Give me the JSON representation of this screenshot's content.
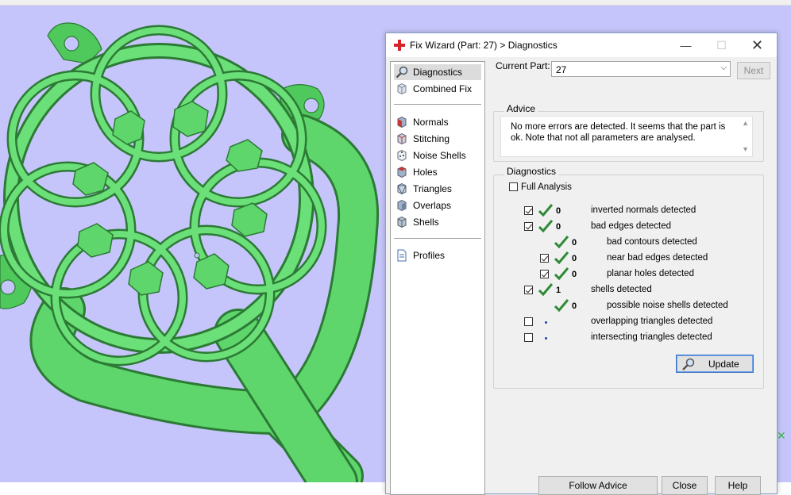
{
  "dialog": {
    "title": "Fix Wizard (Part: 27) > Diagnostics",
    "window_controls": {
      "minimize": "—",
      "maximize": "☐",
      "close": "✕"
    }
  },
  "nav": {
    "items": [
      {
        "label": "Diagnostics",
        "icon": "magnifier-icon",
        "selected": true
      },
      {
        "label": "Combined Fix",
        "icon": "cube-icon"
      },
      {
        "label": "Normals",
        "icon": "normals-cube-icon"
      },
      {
        "label": "Stitching",
        "icon": "stitching-cube-icon"
      },
      {
        "label": "Noise Shells",
        "icon": "dice-icon"
      },
      {
        "label": "Holes",
        "icon": "holes-cube-icon"
      },
      {
        "label": "Triangles",
        "icon": "triangles-cube-icon"
      },
      {
        "label": "Overlaps",
        "icon": "overlaps-cube-icon"
      },
      {
        "label": "Shells",
        "icon": "shells-cube-icon"
      },
      {
        "label": "Profiles",
        "icon": "document-icon"
      }
    ]
  },
  "current_part": {
    "label": "Current Part:",
    "value": "27",
    "next_label": "Next"
  },
  "advice": {
    "title": "Advice",
    "text": "No more errors are detected. It seems that the part is ok. Note that not all parameters are analysed."
  },
  "diagnostics": {
    "title": "Diagnostics",
    "full_analysis_label": "Full Analysis",
    "full_analysis_checked": false,
    "rows": [
      {
        "checkbox": true,
        "checked": true,
        "status": "tick",
        "count": "0",
        "label": "inverted normals detected",
        "indent": 0
      },
      {
        "checkbox": true,
        "checked": true,
        "status": "tick",
        "count": "0",
        "label": "bad edges detected",
        "indent": 0
      },
      {
        "checkbox": false,
        "checked": false,
        "status": "tick",
        "count": "0",
        "label": "bad contours detected",
        "indent": 1
      },
      {
        "checkbox": true,
        "checked": true,
        "status": "tick",
        "count": "0",
        "label": "near bad edges detected",
        "indent": 1
      },
      {
        "checkbox": true,
        "checked": true,
        "status": "tick",
        "count": "0",
        "label": "planar holes detected",
        "indent": 1
      },
      {
        "checkbox": true,
        "checked": true,
        "status": "tick",
        "count": "1",
        "label": "shells detected",
        "indent": 0
      },
      {
        "checkbox": false,
        "checked": false,
        "status": "tick",
        "count": "0",
        "label": "possible noise shells detected",
        "indent": 1
      },
      {
        "checkbox": true,
        "checked": false,
        "status": "dot",
        "count": "",
        "label": "overlapping triangles detected",
        "indent": 0
      },
      {
        "checkbox": true,
        "checked": false,
        "status": "dot",
        "count": "",
        "label": "intersecting triangles detected",
        "indent": 0
      }
    ],
    "update_label": "Update"
  },
  "bottom_buttons": {
    "follow_advice": "Follow Advice",
    "close": "Close",
    "help": "Help"
  },
  "colors": {
    "viewport_bg": "#c5c5fb",
    "model_green": "#5ed66b",
    "tick_green": "#2e8a37"
  }
}
